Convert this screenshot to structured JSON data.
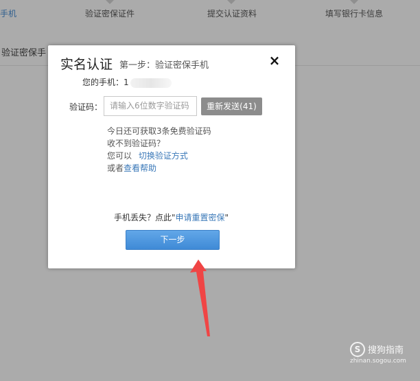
{
  "background": {
    "steps": [
      {
        "label": "手机",
        "active": true
      },
      {
        "label": "验证密保证件",
        "active": false
      },
      {
        "label": "提交认证资料",
        "active": false
      },
      {
        "label": "填写银行卡信息",
        "active": false
      }
    ],
    "heading": "验证密保手"
  },
  "modal": {
    "title": "实名认证",
    "subtitle": "第一步：验证密保手机",
    "close_icon": "×",
    "phone_label": "您的手机：",
    "phone_prefix": "1",
    "code_label": "验证码：",
    "code_placeholder": "请输入6位数字验证码",
    "code_value": "",
    "resend_label": "重新发送(41)",
    "hint_free_codes": "今日还可获取3条免费验证码",
    "hint_not_received": "收不到验证码？",
    "hint_switch_prefix": "您可以",
    "hint_switch_link": "切换验证方式",
    "hint_help_prefix": "或者",
    "hint_help_link": "查看帮助",
    "lost_prefix": "手机丢失？点此\"",
    "lost_link": "申请重置密保",
    "lost_suffix": "\"",
    "next_label": "下一步"
  },
  "watermark": {
    "logo_glyph": "S",
    "text": "搜狗指南",
    "url": "zhinan.sogou.com"
  },
  "colors": {
    "overlay": "#ababab",
    "link": "#3a78b8",
    "primary_button": "#4a95dd",
    "disabled_button": "#8c8c8c",
    "arrow": "#f04545"
  }
}
